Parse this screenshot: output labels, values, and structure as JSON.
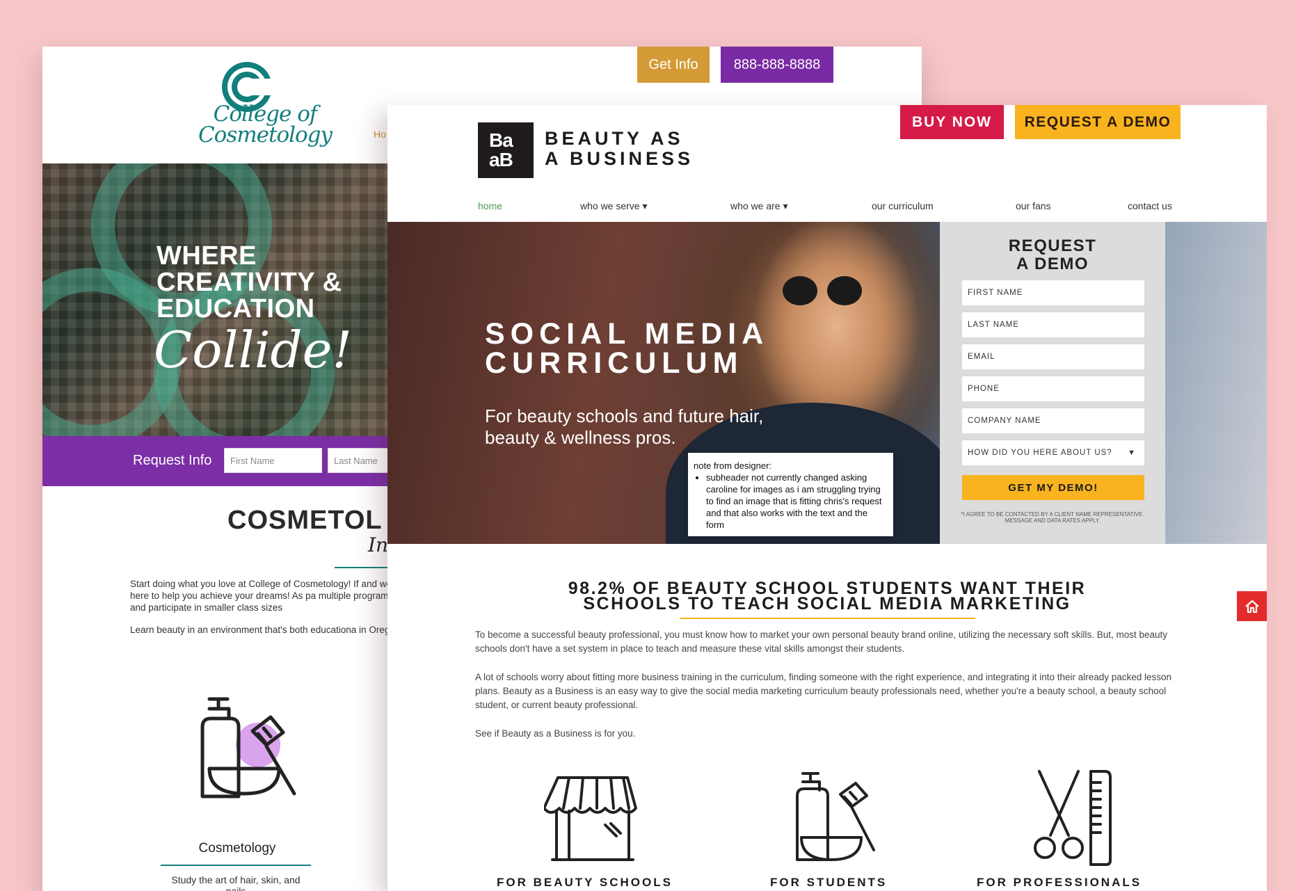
{
  "cosmetology": {
    "logo_line1": "College of",
    "logo_line2": "Cosmetology",
    "nav_home": "Ho",
    "get_info_label": "Get Info",
    "phone_label": "888-888-8888",
    "hero_line1": "WHERE",
    "hero_line2": "CREATIVITY &",
    "hero_line3": "EDUCATION",
    "hero_script": "Collide!",
    "request_info_label": "Request Info",
    "first_name_placeholder": "First Name",
    "last_name_placeholder": "Last Name",
    "section_title": "COSMETOL",
    "section_script": "In",
    "paragraph1": "Start doing what you love at College of Cosmetology! If and we are here to help you achieve your dreams! As pa multiple programs and participate in smaller class sizes",
    "paragraph2": "Learn beauty in an environment that's both educationa in Oregon.",
    "card_title": "Cosmetology",
    "card_text": "Study the art of hair, skin, and nails"
  },
  "baab": {
    "logo_top": "Ba",
    "logo_bottom": "aB",
    "brand_line1": "BEAUTY AS",
    "brand_line2": "A BUSINESS",
    "buy_now_label": "BUY NOW",
    "request_demo_label": "REQUEST A DEMO",
    "nav": [
      "home",
      "who we serve ▾",
      "who we are ▾",
      "our curriculum",
      "our fans",
      "contact us"
    ],
    "hero_title_line1": "SOCIAL MEDIA",
    "hero_title_line2": "CURRICULUM",
    "hero_subtitle": "For beauty schools and future hair, beauty & wellness pros.",
    "note_heading": "note from designer:",
    "note_item": "subheader not currently changed asking caroline for images as i am struggling trying to find an image that is fitting chris's request and that also works with the text and the form",
    "form": {
      "title_line1": "REQUEST",
      "title_line2": "A DEMO",
      "fields": [
        "FIRST NAME",
        "LAST NAME",
        "EMAIL",
        "PHONE",
        "COMPANY NAME",
        "HOW DID YOU HERE ABOUT US?"
      ],
      "submit_label": "GET MY DEMO!",
      "disclaimer": "*I AGREE TO BE CONTACTED BY A CLIENT NAME REPRESENTATIVE. MESSAGE AND DATA RATES APPLY."
    },
    "section_title_line1": "98.2% OF BEAUTY SCHOOL STUDENTS WANT THEIR",
    "section_title_line2": "SCHOOLS TO TEACH SOCIAL MEDIA MARKETING",
    "paragraph1": "To become a successful beauty professional, you must know how to market your own personal beauty brand online, utilizing the necessary soft skills. But, most beauty schools don't have a set system in place to teach and measure these vital skills amongst their students.",
    "paragraph2": "A lot of schools worry about fitting more business training in the curriculum, finding someone with the right experience, and integrating it into their already packed lesson plans. Beauty as a Business is an easy way to give the social media marketing curriculum beauty professionals need, whether you're a beauty school, a beauty school student, or current beauty professional.",
    "paragraph3": "See if Beauty as a Business is for you.",
    "cards": [
      "FOR BEAUTY SCHOOLS",
      "FOR STUDENTS",
      "FOR PROFESSIONALS"
    ]
  },
  "colors": {
    "background": "#f6c6c8",
    "teal": "#127f7c",
    "purple": "#7b2ea6",
    "gold": "#d39a35",
    "buy_red": "#d51a48",
    "demo_yellow": "#f8b31f",
    "home_red": "#e32b2b"
  },
  "icons": [
    "store-awning-icon",
    "bottle-bowl-brush-icon",
    "scissors-comb-icon",
    "home-icon"
  ]
}
